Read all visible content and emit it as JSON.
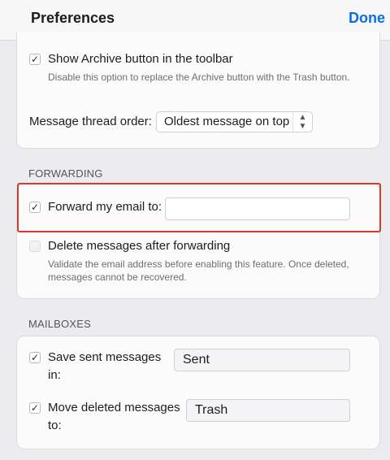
{
  "header": {
    "title": "Preferences",
    "done_label": "Done"
  },
  "general": {
    "archive_label": "Show Archive button in the toolbar",
    "archive_help": "Disable this option to replace the Archive button with the Trash button.",
    "archive_checked": true,
    "thread_order_label": "Message thread order:",
    "thread_order_value": "Oldest message on top"
  },
  "forwarding": {
    "section_label": "FORWARDING",
    "forward_label": "Forward my email to:",
    "forward_checked": true,
    "forward_value": "",
    "delete_label": "Delete messages after forwarding",
    "delete_checked": false,
    "delete_help": "Validate the email address before enabling this feature. Once deleted, messages cannot be recovered.",
    "highlight_color": "#d93a2b"
  },
  "mailboxes": {
    "section_label": "MAILBOXES",
    "sent_label_line1": "Save sent messages",
    "sent_label_line2": "in:",
    "sent_value": "Sent",
    "sent_checked": true,
    "trash_label_line1": "Move deleted messages",
    "trash_label_line2": "to:",
    "trash_value": "Trash",
    "trash_checked": true
  },
  "colors": {
    "accent": "#0a6fe0",
    "background": "#ececef"
  }
}
